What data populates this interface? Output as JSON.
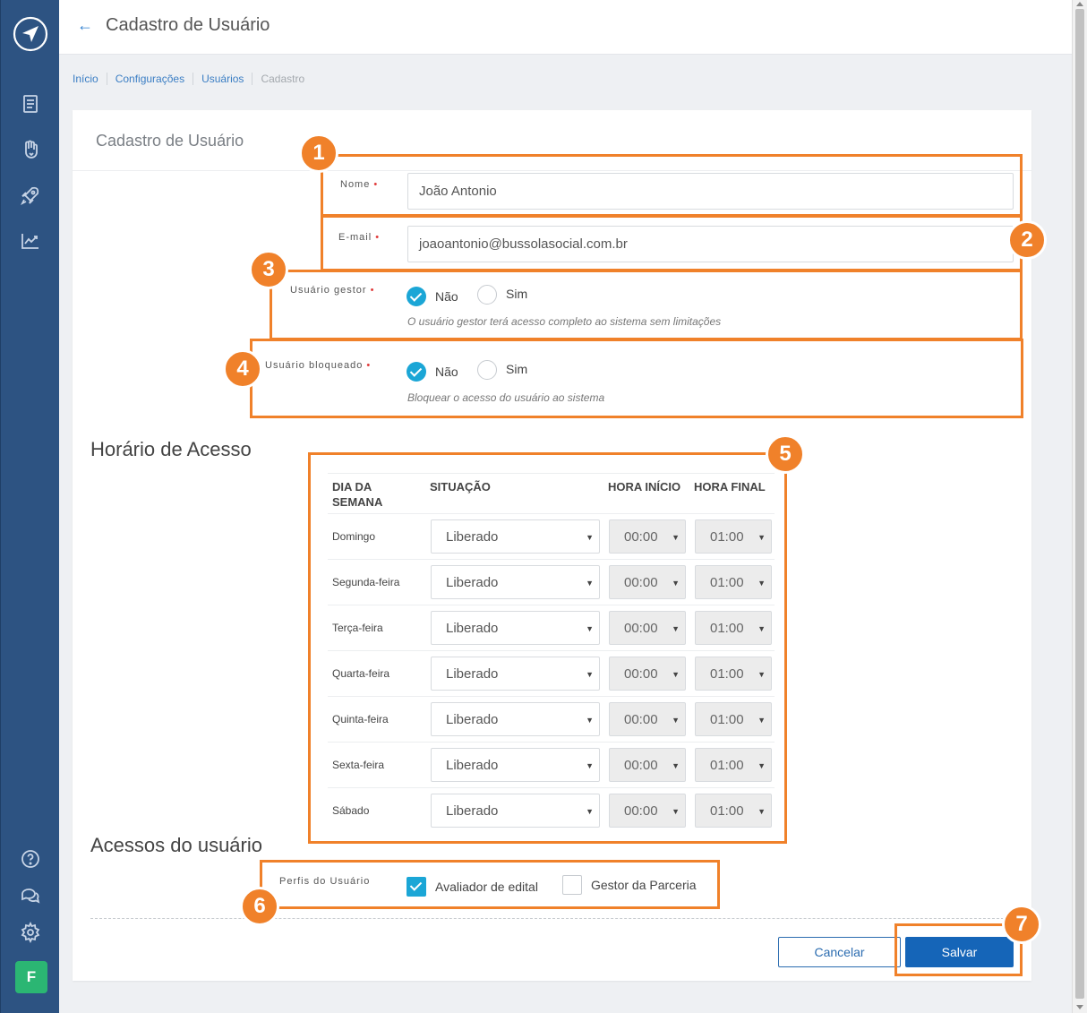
{
  "header": {
    "title": "Cadastro de Usuário"
  },
  "breadcrumb": [
    "Início",
    "Configurações",
    "Usuários",
    "Cadastro"
  ],
  "card": {
    "title": "Cadastro de Usuário"
  },
  "form": {
    "nome": {
      "label": "Nome",
      "value": "João Antonio"
    },
    "email": {
      "label": "E-mail",
      "value": "joaoantonio@bussolasocial.com.br"
    },
    "gestor": {
      "label": "Usuário gestor",
      "options": [
        "Não",
        "Sim"
      ],
      "selected": "Não",
      "hint": "O usuário gestor terá acesso completo ao sistema sem limitações"
    },
    "bloqueado": {
      "label": "Usuário bloqueado",
      "options": [
        "Não",
        "Sim"
      ],
      "selected": "Não",
      "hint": "Bloquear o acesso do usuário ao sistema"
    },
    "required_marker": "•"
  },
  "schedule": {
    "title": "Horário de Acesso",
    "headers": {
      "day_line1": "DIA DA",
      "day_line2": "SEMANA",
      "status": "SITUAÇÃO",
      "start": "HORA INÍCIO",
      "end": "HORA FINAL"
    },
    "rows": [
      {
        "day": "Domingo",
        "status": "Liberado",
        "start": "00:00",
        "end": "01:00"
      },
      {
        "day": "Segunda-feira",
        "status": "Liberado",
        "start": "00:00",
        "end": "01:00"
      },
      {
        "day": "Terça-feira",
        "status": "Liberado",
        "start": "00:00",
        "end": "01:00"
      },
      {
        "day": "Quarta-feira",
        "status": "Liberado",
        "start": "00:00",
        "end": "01:00"
      },
      {
        "day": "Quinta-feira",
        "status": "Liberado",
        "start": "00:00",
        "end": "01:00"
      },
      {
        "day": "Sexta-feira",
        "status": "Liberado",
        "start": "00:00",
        "end": "01:00"
      },
      {
        "day": "Sábado",
        "status": "Liberado",
        "start": "00:00",
        "end": "01:00"
      }
    ]
  },
  "access": {
    "title": "Acessos do usuário",
    "profiles_label": "Perfis do Usuário",
    "profiles": [
      {
        "label": "Avaliador de edital",
        "checked": true
      },
      {
        "label": "Gestor da Parceria",
        "checked": false
      }
    ]
  },
  "buttons": {
    "cancel": "Cancelar",
    "save": "Salvar"
  },
  "sidebar": {
    "avatar_letter": "F",
    "icons": [
      "document-icon",
      "hand-heart-icon",
      "rocket-icon",
      "chart-icon",
      "help-icon",
      "chat-icon",
      "gear-icon"
    ]
  },
  "annotations": [
    "1",
    "2",
    "3",
    "4",
    "5",
    "6",
    "7"
  ],
  "colors": {
    "sidebar": "#2d5382",
    "accent": "#1ba6d6",
    "primary_button": "#1565b8",
    "annotation": "#f0812a",
    "avatar": "#2bb673"
  }
}
